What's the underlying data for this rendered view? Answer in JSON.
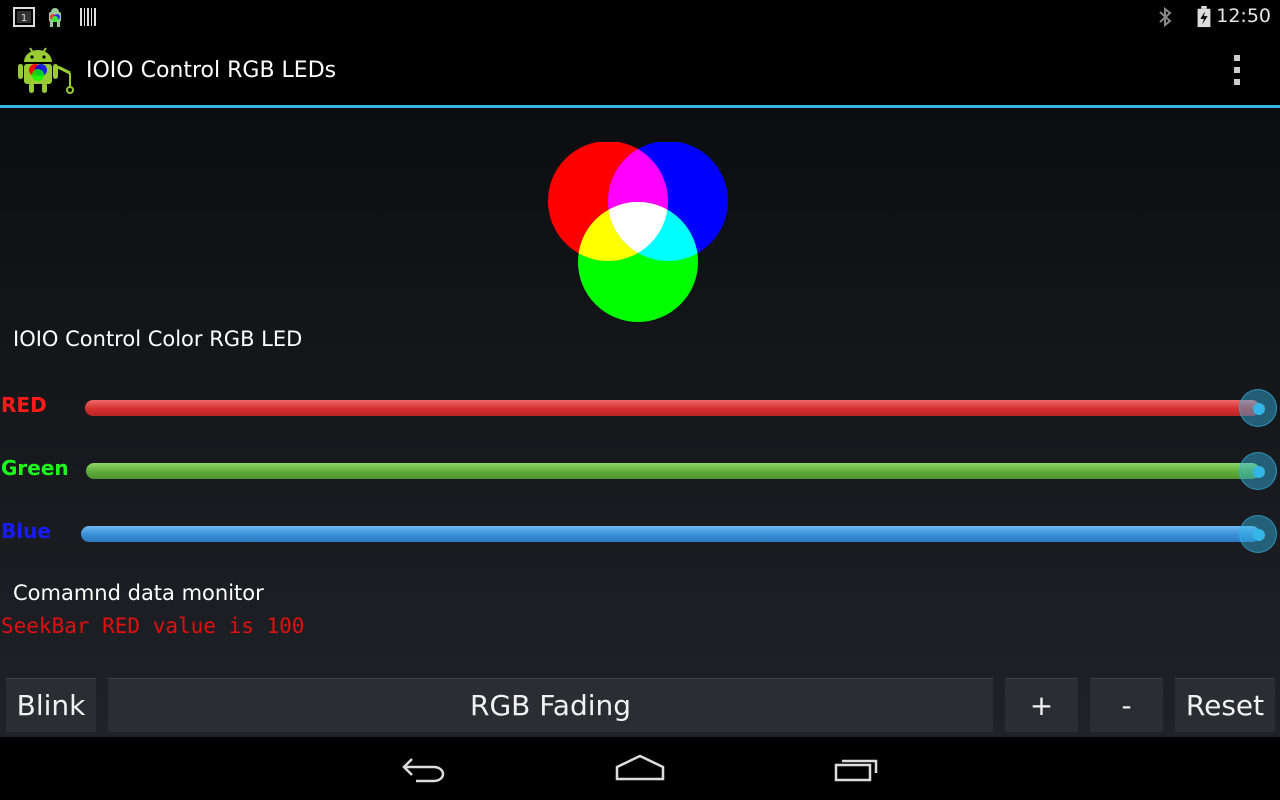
{
  "status_bar": {
    "time": "12:50",
    "left_icons": [
      "notification-1-icon",
      "android-debug-icon",
      "barcode-icon"
    ],
    "right_icons": [
      "bluetooth-icon",
      "battery-charging-icon"
    ]
  },
  "action_bar": {
    "title": "IOIO Control RGB LEDs",
    "app_icon": "android-rgb-app-icon",
    "overflow_icon": "overflow-menu-icon",
    "accent_color": "#33b5e5"
  },
  "main": {
    "section_title": "IOIO Control Color RGB LED",
    "sliders": [
      {
        "label": "RED",
        "label_color": "#ff1a1a",
        "value": 100,
        "max": 100
      },
      {
        "label": "Green",
        "label_color": "#1aff1a",
        "value": 100,
        "max": 100
      },
      {
        "label": "Blue",
        "label_color": "#1a1aff",
        "value": 100,
        "max": 100
      }
    ],
    "monitor_title": "Comamnd data monitor",
    "monitor_output": "SeekBar RED value is 100",
    "monitor_color": "#e01010"
  },
  "buttons": {
    "blink": "Blink",
    "rgb_fading": "RGB Fading",
    "plus": "+",
    "minus": "-",
    "reset": "Reset"
  },
  "nav_bar": {
    "icons": [
      "back-icon",
      "home-icon",
      "recent-apps-icon"
    ]
  }
}
